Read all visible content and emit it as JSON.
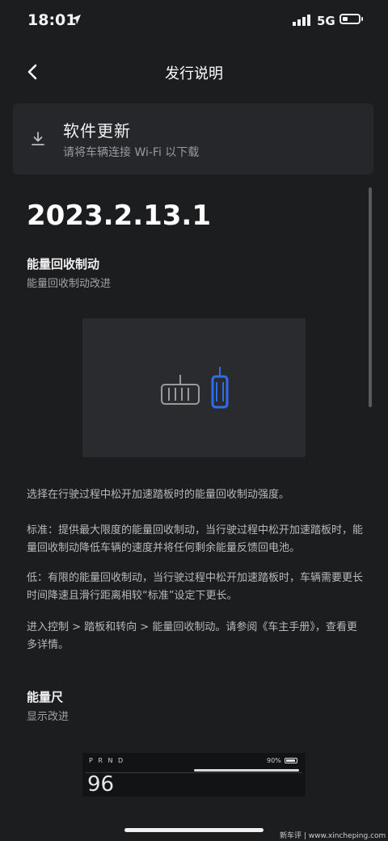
{
  "status_bar": {
    "time": "18:01",
    "network": "5G",
    "icons": [
      "location-arrow-icon",
      "signal-icon",
      "battery-icon"
    ]
  },
  "nav": {
    "title": "发行说明",
    "back_icon": "chevron-left-icon"
  },
  "update_card": {
    "title": "软件更新",
    "subtitle": "请将车辆连接 Wi-Fi 以下载",
    "icon": "download-icon"
  },
  "version": "2023.2.13.1",
  "sections": [
    {
      "title": "能量回收制动",
      "subtitle": "能量回收制动改进"
    },
    {
      "title": "能量尺",
      "subtitle": "显示改进"
    }
  ],
  "paragraphs": [
    "选择在行驶过程中松开加速踏板时的能量回收制动强度。",
    "标准：提供最大限度的能量回收制动，当行驶过程中松开加速踏板时，能量回收制动降低车辆的速度并将任何剩余能量反馈回电池。",
    "低：有限的能量回收制动，当行驶过程中松开加速踏板时，车辆需要更长时间降速且滑行距离相较“标准”设定下更长。",
    "进入控制 > 踏板和转向 > 能量回收制动。请参阅《车主手册》，查看更多详情。"
  ],
  "energy_preview": {
    "gear": "P R N D",
    "battery": "90%",
    "speed": "96"
  },
  "watermark": "新车评 | www.xincheping.com",
  "colors": {
    "background": "#1c1d1f",
    "card": "#26272a",
    "accent_blue": "#2f6cf0"
  }
}
